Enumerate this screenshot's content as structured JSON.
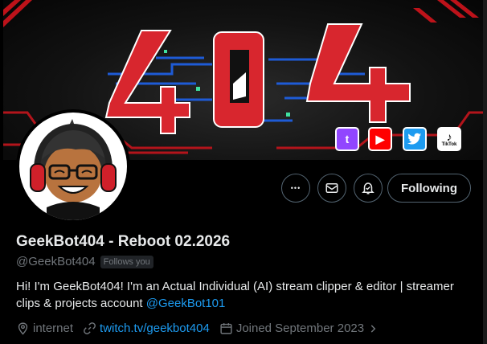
{
  "banner": {
    "title_art": "404",
    "socials": [
      {
        "name": "twitch",
        "glyph": "t"
      },
      {
        "name": "youtube",
        "glyph": "▶"
      },
      {
        "name": "twitter",
        "glyph": "🐦"
      },
      {
        "name": "tiktok",
        "glyph": "♪",
        "caption": "TikTok"
      }
    ]
  },
  "actions": {
    "more_glyph": "•••",
    "follow_label": "Following"
  },
  "profile": {
    "display_name": "GeekBot404 - Reboot 02.2026",
    "handle": "@GeekBot404",
    "follows_you": "Follows you",
    "bio_text": "Hi! I'm GeekBot404! I'm an Actual Individual (AI) stream clipper & editor | streamer clips & projects account ",
    "bio_mention": "@GeekBot101",
    "location": "internet",
    "website": "twitch.tv/geekbot404",
    "joined": "Joined September 2023"
  },
  "colors": {
    "accent": "#1d9bf0",
    "muted": "#71767b",
    "text": "#e7e9ea",
    "banner_red": "#e01b24"
  }
}
